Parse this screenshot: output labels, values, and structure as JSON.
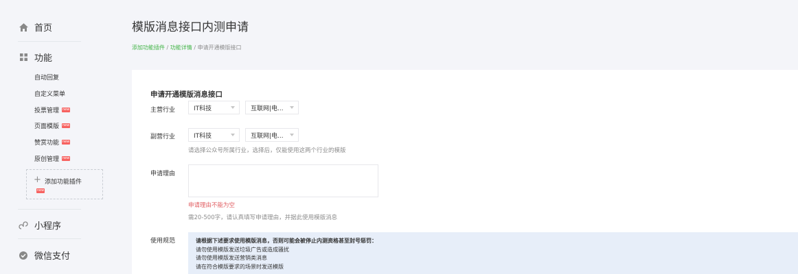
{
  "sidebar": {
    "home": {
      "label": "首页",
      "icon": "home-icon"
    },
    "features": {
      "label": "功能",
      "icon": "grid-icon",
      "items": [
        {
          "label": "自动回复",
          "new": false
        },
        {
          "label": "自定义菜单",
          "new": false
        },
        {
          "label": "投票管理",
          "new": true
        },
        {
          "label": "页面模版",
          "new": true
        },
        {
          "label": "赞赏功能",
          "new": true
        },
        {
          "label": "原创管理",
          "new": true
        }
      ],
      "add_plugin": {
        "label": "添加功能插件",
        "new": true
      }
    },
    "mini_program": {
      "label": "小程序",
      "icon": "mini-program-icon"
    },
    "wechat_pay": {
      "label": "微信支付",
      "icon": "wechat-pay-icon"
    }
  },
  "header": {
    "title": "模版消息接口内测申请",
    "breadcrumb": [
      {
        "label": "添加功能插件",
        "link": true
      },
      {
        "label": "功能详情",
        "link": true
      },
      {
        "label": "申请开通模版接口",
        "link": false
      }
    ],
    "separator": " / "
  },
  "form": {
    "title": "申请开通模版消息接口",
    "primary_industry": {
      "label": "主营行业",
      "select1": "IT科技",
      "select2": "互联网|电..."
    },
    "secondary_industry": {
      "label": "副营行业",
      "select1": "IT科技",
      "select2": "互联网|电..."
    },
    "industry_hint": "请选择公众号所属行业，选择后，仅能使用这两个行业的模版",
    "reason": {
      "label": "申请理由",
      "value": "",
      "error": "申请理由不能为空",
      "hint": "需20-500字，请认真填写申请理由，并据此使用模版消息"
    },
    "rules": {
      "label": "使用规范",
      "heading": "请根据下述要求使用模版消息，否则可能会被停止内测资格甚至封号惩罚：",
      "lines": [
        "请勿使用模版发送垃圾广告或造成骚扰",
        "请勿使用模版发送营销类消息",
        "请在符合模版要求的场景时发送模版"
      ]
    }
  },
  "colors": {
    "accent_green": "#44b549",
    "error_red": "#e15f63",
    "badge_red": "#f76260",
    "rules_bg": "#e7eef9"
  },
  "badge_text": "new"
}
